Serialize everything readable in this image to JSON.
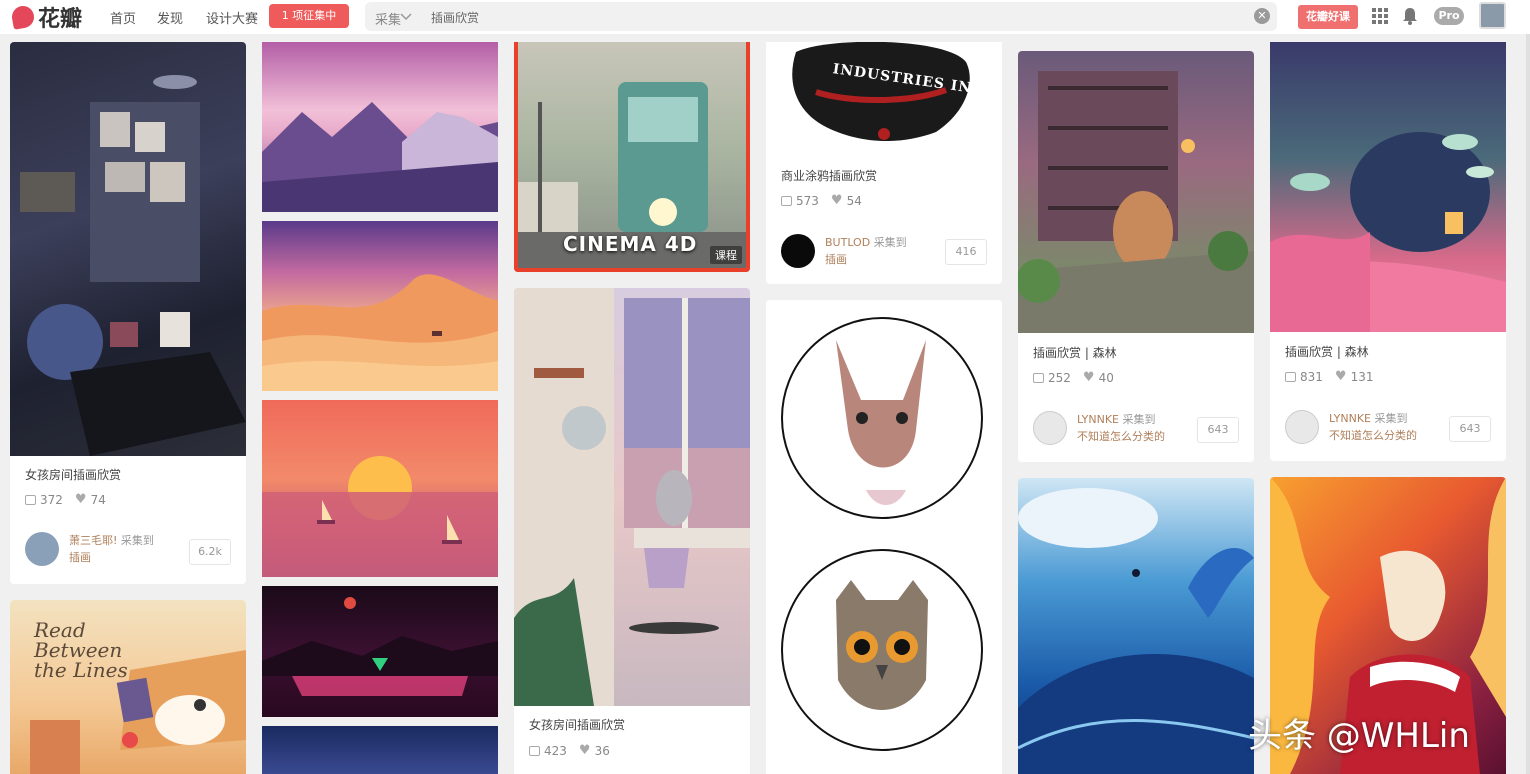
{
  "brand": {
    "name": "花瓣"
  },
  "nav": {
    "home": "首页",
    "discover": "发现",
    "contest": "设计大赛",
    "badge": "1 项征集中"
  },
  "search": {
    "scope": "采集",
    "query": "插画欣赏"
  },
  "header_right": {
    "promo": "花瓣好课",
    "pro": "Pro"
  },
  "pins": {
    "p1": {
      "caption": "女孩房间插画欣赏",
      "repins": "372",
      "likes": "74",
      "user": "萧三毛耶!",
      "action": "采集到",
      "board": "插画",
      "count": "6.2k"
    },
    "p2": {
      "overlay": "CINEMA 4D",
      "tag": "课程"
    },
    "p3": {
      "caption": "女孩房间插画欣赏",
      "repins": "423",
      "likes": "36"
    },
    "p4": {
      "logo_text": "INDUSTRIES INC.",
      "caption": "商业涂鸦插画欣赏",
      "repins": "573",
      "likes": "54",
      "user": "BUTLOD",
      "action": "采集到",
      "board": "插画",
      "count": "416"
    },
    "p5": {
      "caption": "插画欣赏 | 森林",
      "repins": "252",
      "likes": "40",
      "user": "LYNNKE",
      "action": "采集到",
      "board": "不知道怎么分类的",
      "count": "643"
    },
    "p6": {
      "caption": "插画欣赏 | 森林",
      "repins": "831",
      "likes": "131",
      "user": "LYNNKE",
      "action": "采集到",
      "board": "不知道怎么分类的",
      "count": "643"
    },
    "p7": {
      "book_text": "Read Between the Lines"
    }
  },
  "watermark": "头条 @WHLin"
}
